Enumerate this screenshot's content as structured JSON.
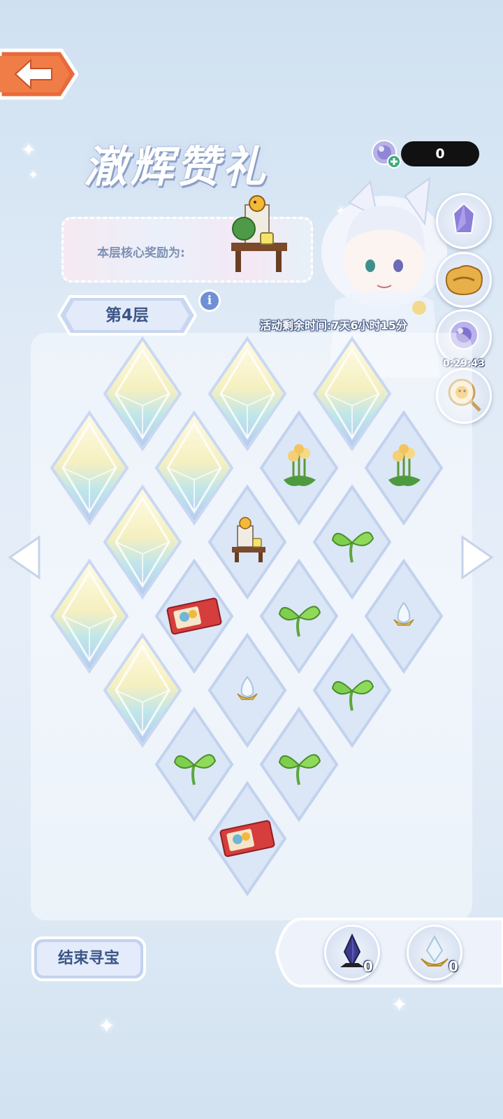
{
  "event": {
    "title": "澈辉赞礼"
  },
  "currency": {
    "value": "0",
    "icon": "crystal-orb-plus-icon"
  },
  "reward": {
    "label": "本层核心奖励为:",
    "item_icon": "chick-garden-table-icon"
  },
  "floor": {
    "label": "第4层"
  },
  "event_timer": {
    "text": "活动剩余时间:7天6小时15分"
  },
  "side_buttons": [
    {
      "icon": "purple-crystal-icon"
    },
    {
      "icon": "gold-chest-icon"
    },
    {
      "icon": "crystal-orb-timer-icon",
      "timer": "0:29:43"
    },
    {
      "icon": "chick-magnifier-icon"
    }
  ],
  "board": {
    "tiles": [
      {
        "type": "crystal"
      },
      {
        "type": "crystal"
      },
      {
        "type": "crystal"
      },
      {
        "type": "crystal"
      },
      {
        "type": "crystal"
      },
      {
        "type": "flower"
      },
      {
        "type": "flower"
      },
      {
        "type": "crystal"
      },
      {
        "type": "garden-table"
      },
      {
        "type": "sprout"
      },
      {
        "type": "crystal"
      },
      {
        "type": "ticket"
      },
      {
        "type": "sprout"
      },
      {
        "type": "egg"
      },
      {
        "type": "crystal"
      },
      {
        "type": "egg"
      },
      {
        "type": "sprout"
      },
      {
        "type": "sprout"
      },
      {
        "type": "sprout"
      },
      {
        "type": "ticket"
      }
    ]
  },
  "end_button": {
    "label": "结束寻宝"
  },
  "inventory": [
    {
      "icon": "dark-crystal-icon",
      "count": "0"
    },
    {
      "icon": "light-crystal-icon",
      "count": "0"
    }
  ],
  "colors": {
    "accent": "#3c5586",
    "panel": "#dfeaf6"
  }
}
